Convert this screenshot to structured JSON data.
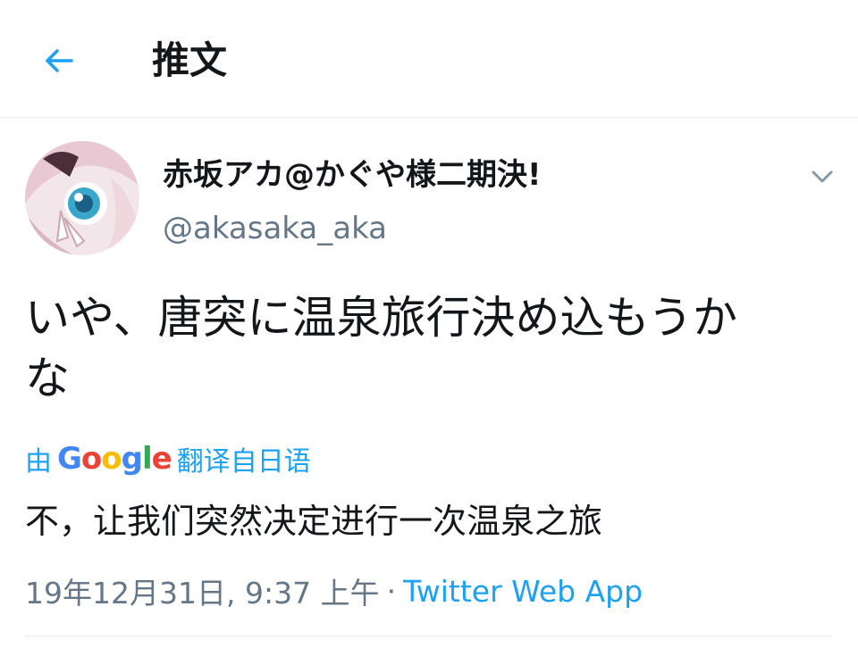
{
  "header": {
    "title": "推文"
  },
  "tweet": {
    "author": {
      "display_name": "赤坂アカ@かぐや様二期決!",
      "handle": "@akasaka_aka"
    },
    "text_line1": "いや、唐突に温泉旅行決め込もうか",
    "text_line2": "な",
    "translation": {
      "prefix": "由",
      "logo": {
        "G": "G",
        "o1": "o",
        "o2": "o",
        "g": "g",
        "l": "l",
        "e": "e"
      },
      "suffix": "翻译自日语",
      "text": "不，让我们突然决定进行一次温泉之旅"
    },
    "meta": {
      "date": "19年12月31日, 9:37 上午",
      "separator": "·",
      "source": "Twitter Web App"
    }
  },
  "colors": {
    "accent": "#1da1f2",
    "secondary_text": "#657786",
    "divider": "#e6ecf0",
    "google_blue": "#4285f4",
    "google_red": "#ea4335",
    "google_yellow": "#fbbc05",
    "google_green": "#34a853"
  },
  "icons": {
    "back": "arrow-left-icon",
    "caret": "chevron-down-icon"
  }
}
